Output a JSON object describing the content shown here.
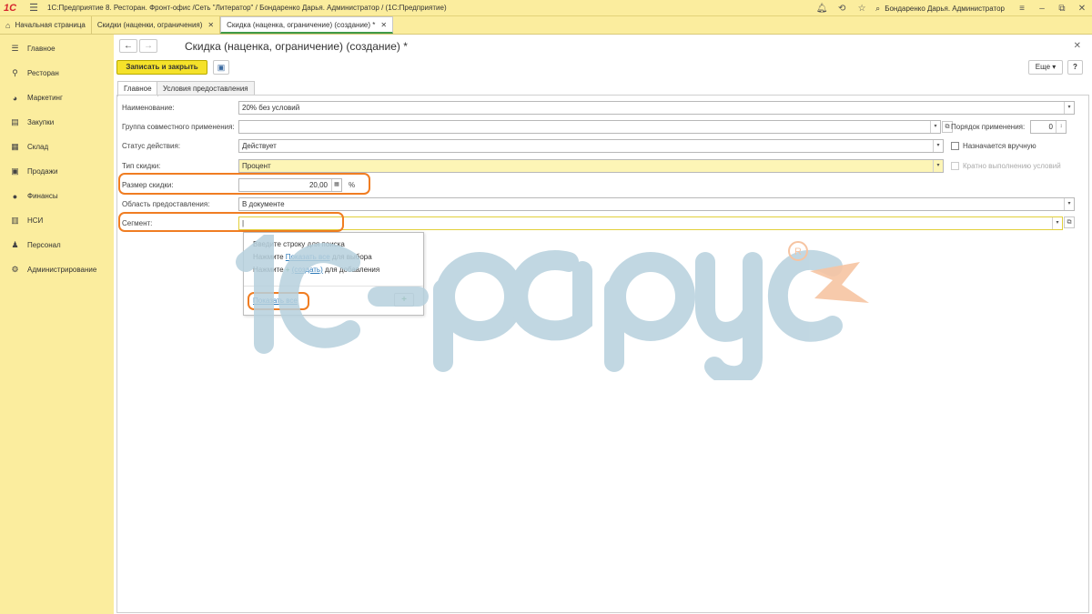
{
  "titlebar": {
    "logo": "1С",
    "title": "1С:Предприятие 8. Ресторан. Фронт-офис /Сеть \"Литератор\" / Бондаренко Дарья. Администратор /  (1С:Предприятие)",
    "user": "Бондаренко Дарья. Администратор"
  },
  "tabs": [
    {
      "label": "Начальная страница"
    },
    {
      "label": "Скидки (наценки, ограничения)"
    },
    {
      "label": "Скидка (наценка, ограничение) (создание) *"
    }
  ],
  "sidebar": {
    "items": [
      {
        "label": "Главное",
        "icon": "menu-lines-icon"
      },
      {
        "label": "Ресторан",
        "icon": "restaurant-icon"
      },
      {
        "label": "Маркетинг",
        "icon": "pie-icon"
      },
      {
        "label": "Закупки",
        "icon": "cart-icon"
      },
      {
        "label": "Склад",
        "icon": "warehouse-icon"
      },
      {
        "label": "Продажи",
        "icon": "sales-icon"
      },
      {
        "label": "Финансы",
        "icon": "coin-icon"
      },
      {
        "label": "НСИ",
        "icon": "books-icon"
      },
      {
        "label": "Персонал",
        "icon": "person-icon"
      },
      {
        "label": "Администрирование",
        "icon": "gear-icon"
      }
    ]
  },
  "form": {
    "title": "Скидка (наценка, ограничение) (создание) *",
    "save_close": "Записать и закрыть",
    "more": "Еще",
    "help": "?",
    "tabs": [
      "Главное",
      "Условия предоставления"
    ],
    "fields": {
      "name_label": "Наименование:",
      "name_value": "20% без условий",
      "group_label": "Группа совместного применения:",
      "group_value": "",
      "order_label": "Порядок применения:",
      "order_value": "0",
      "status_label": "Статус действия:",
      "status_value": "Действует",
      "manual_label": "Назначается вручную",
      "type_label": "Тип скидки:",
      "type_value": "Процент",
      "multiple_label": "Кратно выполнению условий",
      "size_label": "Размер скидки:",
      "size_value": "20,00",
      "size_unit": "%",
      "area_label": "Область предоставления:",
      "area_value": "В документе",
      "segment_label": "Сегмент:",
      "segment_value": "|"
    },
    "popup": {
      "line1": "Введите строку для поиска",
      "line2_prefix": "Нажмите ",
      "line2_link": "Показать все",
      "line2_suffix": " для выбора",
      "line3_prefix": "Нажмите ",
      "line3_plus": "+",
      "line3_link": "(создать)",
      "line3_suffix": " для добавления",
      "show_all": "Показать все",
      "add_button": "+"
    }
  },
  "colors": {
    "panel_yellow": "#fbed9e",
    "save_button": "#f5e22a",
    "highlight_orange": "#f07d22",
    "watermark_blue": "#b7d1de",
    "watermark_orange": "#f6c4a2"
  }
}
